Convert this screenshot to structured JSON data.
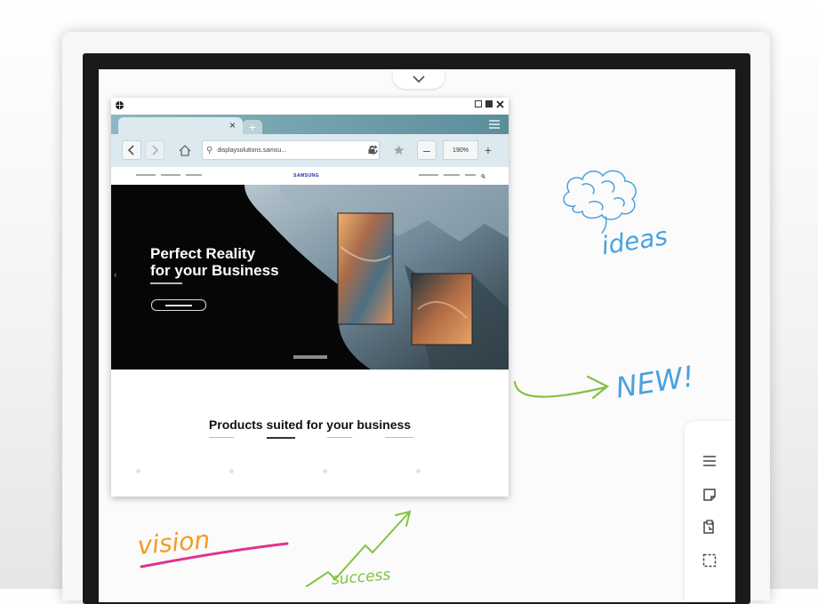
{
  "browser": {
    "tab_close": "×",
    "new_tab": "+",
    "address": "displaysolutions.samsu...",
    "zoom_minus": "–",
    "zoom_value": "190%",
    "zoom_plus": "+"
  },
  "website": {
    "brand": "SAMSUNG",
    "hero_title_line1": "Perfect Reality",
    "hero_title_line2": "for your Business",
    "products_title": "Products suited for your business"
  },
  "handwriting": {
    "ideas": "ideas",
    "new": "NEW!",
    "vision": "vision",
    "success": "success"
  },
  "colors": {
    "accent_teal": "#5b8d9a",
    "ink_blue": "#4aa2dd",
    "ink_green": "#82c341",
    "ink_orange": "#f39a24",
    "ink_pink": "#e0338f"
  },
  "icons": {
    "collapse": "chevron-down-icon",
    "tools": [
      "menu-icon",
      "sticky-note-icon",
      "paste-icon",
      "selection-icon"
    ]
  }
}
